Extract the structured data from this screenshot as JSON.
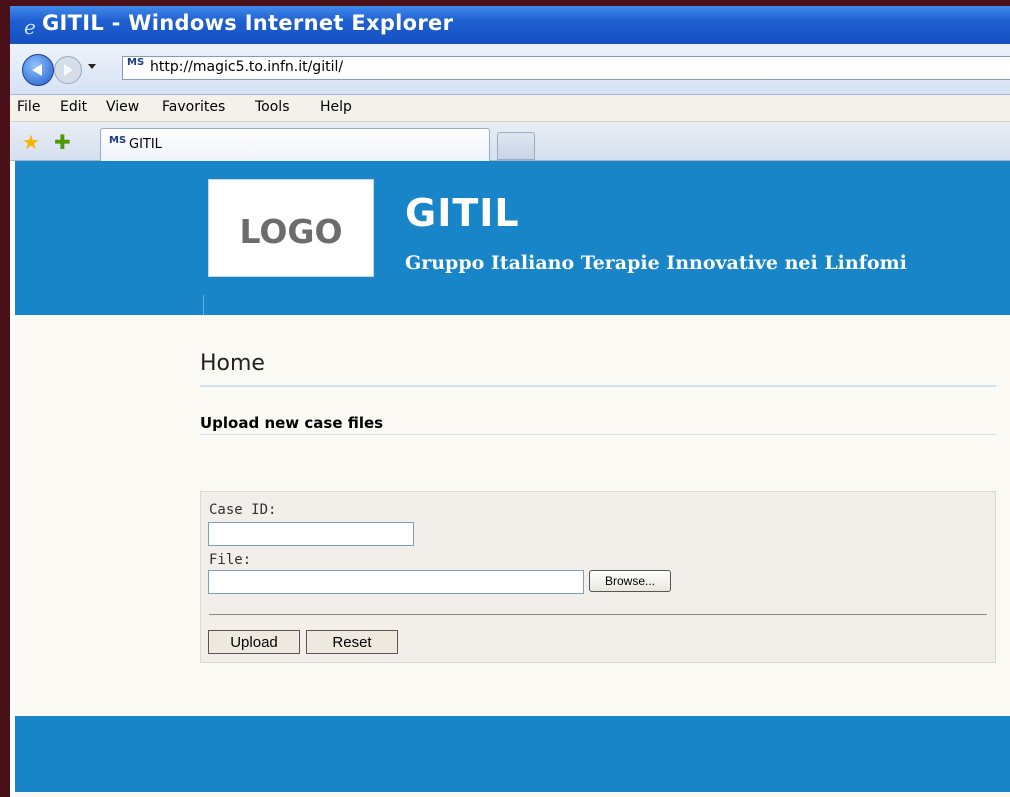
{
  "window": {
    "title": "GITIL - Windows Internet Explorer"
  },
  "addressbar": {
    "url": "http://magic5.to.infn.it/gitil/",
    "site_icon_text": "MS"
  },
  "menubar": {
    "items": [
      "File",
      "Edit",
      "View",
      "Favorites",
      "Tools",
      "Help"
    ]
  },
  "tabs": {
    "active_label": "GITIL",
    "icon_text": "MS"
  },
  "header": {
    "logo": "LOGO",
    "title": "GITIL",
    "subtitle": "Gruppo Italiano Terapie Innovative nei Linfomi"
  },
  "main": {
    "page_title": "Home",
    "section_title": "Upload new case files",
    "form": {
      "case_id_label": "Case ID:",
      "case_id_value": "",
      "file_label": "File:",
      "file_value": "",
      "browse_label": "Browse...",
      "upload_label": "Upload",
      "reset_label": "Reset"
    }
  },
  "colors": {
    "header_bg": "#1785c8",
    "page_bg": "#fbf9f4",
    "form_bg": "#f2efea"
  }
}
